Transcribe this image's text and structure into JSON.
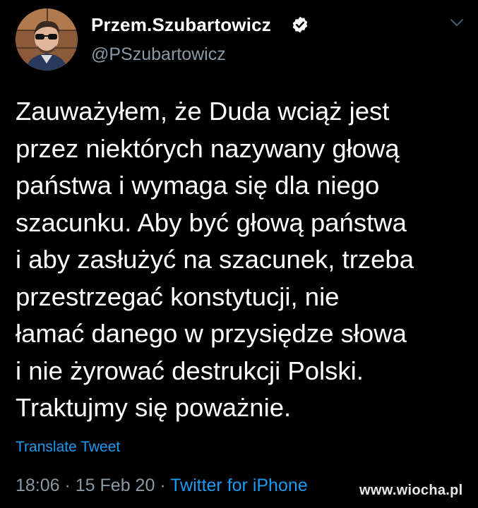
{
  "user": {
    "display_name": "Przem.Szubartowicz",
    "handle": "@PSzubartowicz",
    "verified": true
  },
  "tweet": {
    "text": "Zauważyłem, że Duda wciąż jest\nprzez niektórych nazywany głową\npaństwa i wymaga się dla niego\nszacunku. Aby być głową państwa\ni aby zasłużyć na szacunek, trzeba\nprzestrzegać konstytucji, nie\nłamać danego w przysiędze słowa\ni nie żyrować destrukcji Polski.\nTraktujmy się poważnie.",
    "translate_label": "Translate Tweet",
    "time": "18:06",
    "separator": " · ",
    "date": "15 Feb 20",
    "source": "Twitter for iPhone"
  },
  "watermark": "www.wiocha.pl",
  "icons": {
    "verified": "verified-badge-icon",
    "menu": "chevron-down-icon"
  },
  "colors": {
    "background": "#000000",
    "text": "#ffffff",
    "muted": "#8b98a5",
    "link": "#1d9bf0"
  }
}
